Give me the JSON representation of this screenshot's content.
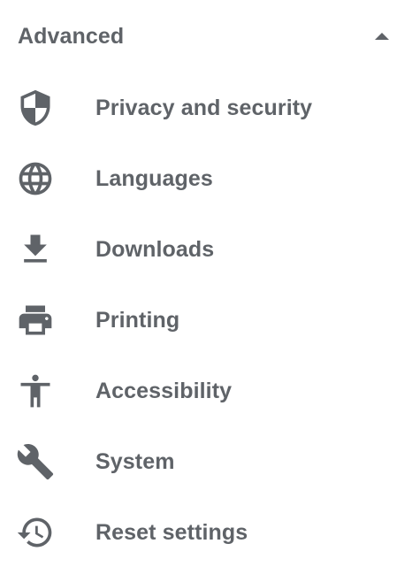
{
  "section": {
    "title": "Advanced",
    "toggle_icon": "arrow-drop-up-icon",
    "expanded": true
  },
  "colors": {
    "text": "#5f6368",
    "icon": "#5f6368",
    "background": "#ffffff"
  },
  "items": [
    {
      "label": "Privacy and security",
      "icon": "shield-icon"
    },
    {
      "label": "Languages",
      "icon": "globe-icon"
    },
    {
      "label": "Downloads",
      "icon": "download-icon"
    },
    {
      "label": "Printing",
      "icon": "printer-icon"
    },
    {
      "label": "Accessibility",
      "icon": "accessibility-icon"
    },
    {
      "label": "System",
      "icon": "wrench-icon"
    },
    {
      "label": "Reset settings",
      "icon": "restore-icon"
    }
  ]
}
